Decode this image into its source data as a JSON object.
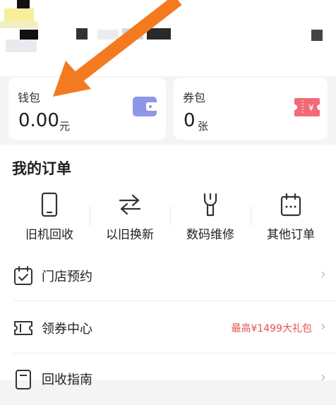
{
  "wallet": {
    "label": "钱包",
    "value": "0.00",
    "unit": "元"
  },
  "coupons": {
    "label": "券包",
    "value": "0",
    "unit": "张"
  },
  "orders": {
    "title": "我的订单",
    "items": [
      {
        "label": "旧机回收",
        "icon": "phone-icon"
      },
      {
        "label": "以旧换新",
        "icon": "exchange-arrows-icon"
      },
      {
        "label": "数码维修",
        "icon": "wrench-icon"
      },
      {
        "label": "其他订单",
        "icon": "calendar-icon"
      }
    ]
  },
  "menu": [
    {
      "label": "门店预约",
      "icon": "calendar-check-icon",
      "extra": ""
    },
    {
      "label": "领券中心",
      "icon": "ticket-icon",
      "extra": "最高¥1499大礼包"
    },
    {
      "label": "回收指南",
      "icon": "guide-icon",
      "extra": ""
    }
  ],
  "colors": {
    "accent": "#e0544f",
    "annotation_arrow": "#f47a20",
    "wallet_icon": "#8e96e6",
    "coupon_icon": "#f26a78"
  }
}
